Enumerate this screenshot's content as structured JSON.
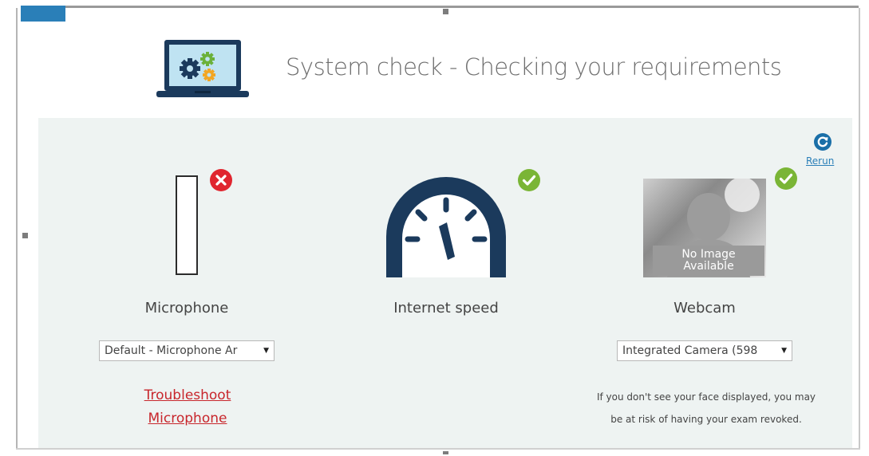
{
  "header": {
    "title": "System check - Checking your requirements",
    "laptop_icon": "laptop-gears-icon"
  },
  "rerun": {
    "icon": "refresh-icon",
    "label": "Rerun"
  },
  "microphone": {
    "label": "Microphone",
    "status": "fail",
    "status_icon": "error-x-icon",
    "level": 0,
    "select_value": "Default - Microphone Ar",
    "troubleshoot_line1": "Troubleshoot",
    "troubleshoot_line2": "Microphone"
  },
  "internet": {
    "label": "Internet speed",
    "status": "pass",
    "status_icon": "check-icon",
    "gauge_icon": "speedometer-icon"
  },
  "webcam": {
    "label": "Webcam",
    "status": "pass",
    "status_icon": "check-icon",
    "no_image_line1": "No Image",
    "no_image_line2": "Available",
    "select_value": "Integrated Camera (598",
    "note_line1": "If you don't see your face displayed, you may",
    "note_line2": "be at risk of having your exam revoked."
  },
  "colors": {
    "accent_blue": "#2a7fb8",
    "navy": "#1b3a5c",
    "error_red": "#e0252f",
    "success_green": "#7ab536",
    "link_red": "#c8262c",
    "panel_bg": "#eef3f2"
  }
}
